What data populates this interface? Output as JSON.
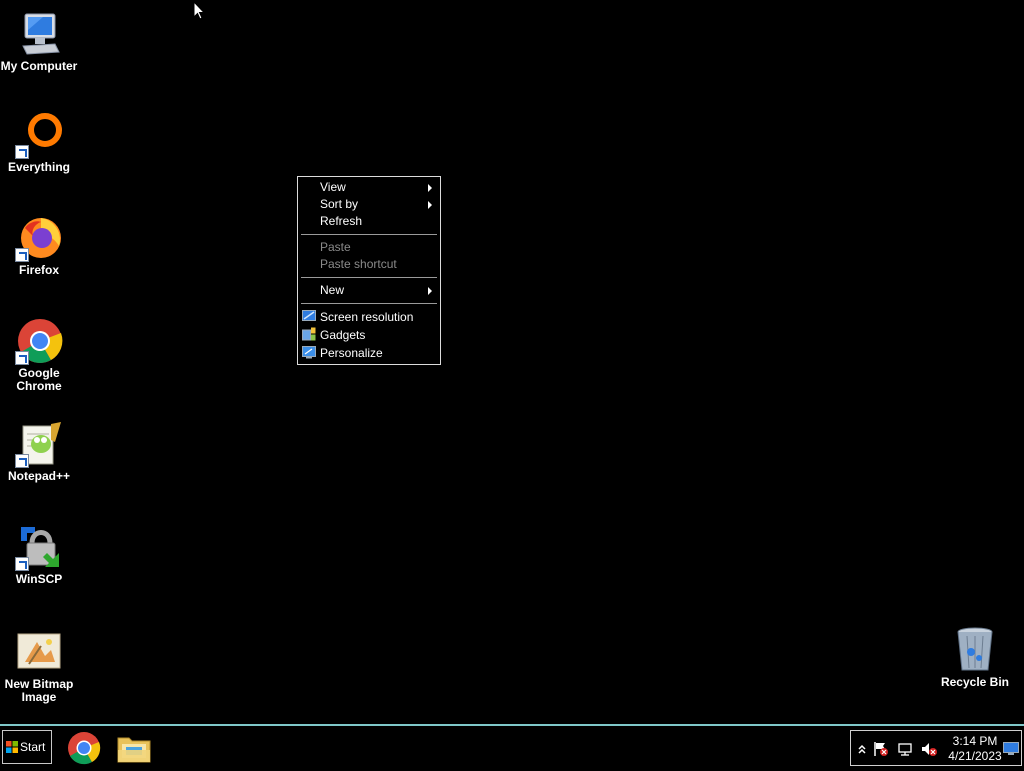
{
  "desktop": {
    "icons": [
      {
        "label": "My Computer",
        "icon": "computer-icon"
      },
      {
        "label": "Everything",
        "icon": "everything-icon"
      },
      {
        "label": "Firefox",
        "icon": "firefox-icon"
      },
      {
        "label": "Google Chrome",
        "icon": "chrome-icon"
      },
      {
        "label": "Notepad++",
        "icon": "notepadpp-icon"
      },
      {
        "label": "WinSCP",
        "icon": "winscp-icon"
      },
      {
        "label": "New Bitmap Image",
        "icon": "bitmap-icon"
      },
      {
        "label": "Recycle Bin",
        "icon": "recycle-bin-icon"
      }
    ]
  },
  "context_menu": {
    "view": "View",
    "sort_by": "Sort by",
    "refresh": "Refresh",
    "paste": "Paste",
    "paste_shortcut": "Paste shortcut",
    "new": "New",
    "screen_resolution": "Screen resolution",
    "gadgets": "Gadgets",
    "personalize": "Personalize"
  },
  "taskbar": {
    "start_label": "Start",
    "pinned": [
      "chrome-icon",
      "file-explorer-icon"
    ],
    "tray_icons": [
      "show-hidden-icons-icon",
      "action-center-flag-icon",
      "network-icon",
      "volume-muted-icon"
    ],
    "time": "3:14 PM",
    "date": "4/21/2023"
  },
  "colors": {
    "desktop_bg": "#000000",
    "taskbar_border": "#7fc7c9"
  }
}
